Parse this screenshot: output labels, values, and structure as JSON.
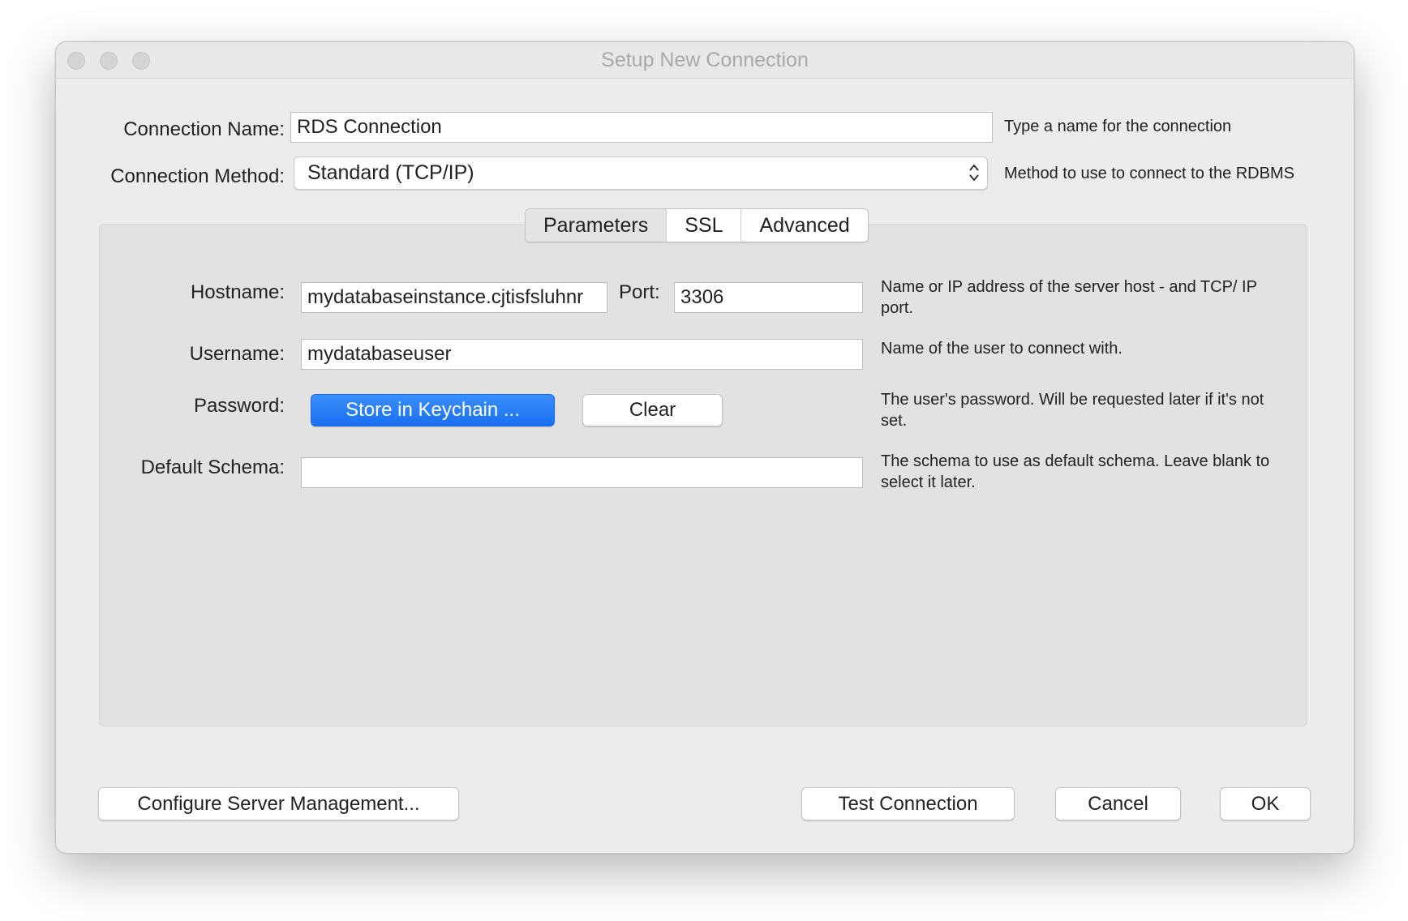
{
  "window": {
    "title": "Setup New Connection"
  },
  "connection_name": {
    "label": "Connection Name:",
    "value": "RDS Connection",
    "hint": "Type a name for the connection"
  },
  "connection_method": {
    "label": "Connection Method:",
    "value": "Standard (TCP/IP)",
    "hint": "Method to use to connect to the RDBMS"
  },
  "tabs": [
    {
      "label": "Parameters",
      "active": true
    },
    {
      "label": "SSL",
      "active": false
    },
    {
      "label": "Advanced",
      "active": false
    }
  ],
  "parameters": {
    "hostname": {
      "label": "Hostname:",
      "value": "mydatabaseinstance.cjtisfsluhnr",
      "hint": "Name or IP address of the server host - and TCP/ IP port."
    },
    "port": {
      "label": "Port:",
      "value": "3306"
    },
    "username": {
      "label": "Username:",
      "value": "mydatabaseuser",
      "hint": "Name of the user to connect with."
    },
    "password": {
      "label": "Password:",
      "store_button": "Store in Keychain ...",
      "clear_button": "Clear",
      "hint": "The user's password. Will be requested later if it's not set."
    },
    "default_schema": {
      "label": "Default Schema:",
      "value": "",
      "hint": "The schema to use as default schema. Leave blank to select it later."
    }
  },
  "footer": {
    "configure_button": "Configure Server Management...",
    "test_button": "Test Connection",
    "cancel_button": "Cancel",
    "ok_button": "OK"
  },
  "colors": {
    "primary_button": "#1a6ff1",
    "window_bg": "#ececec",
    "panel_bg": "#e2e2e2"
  }
}
